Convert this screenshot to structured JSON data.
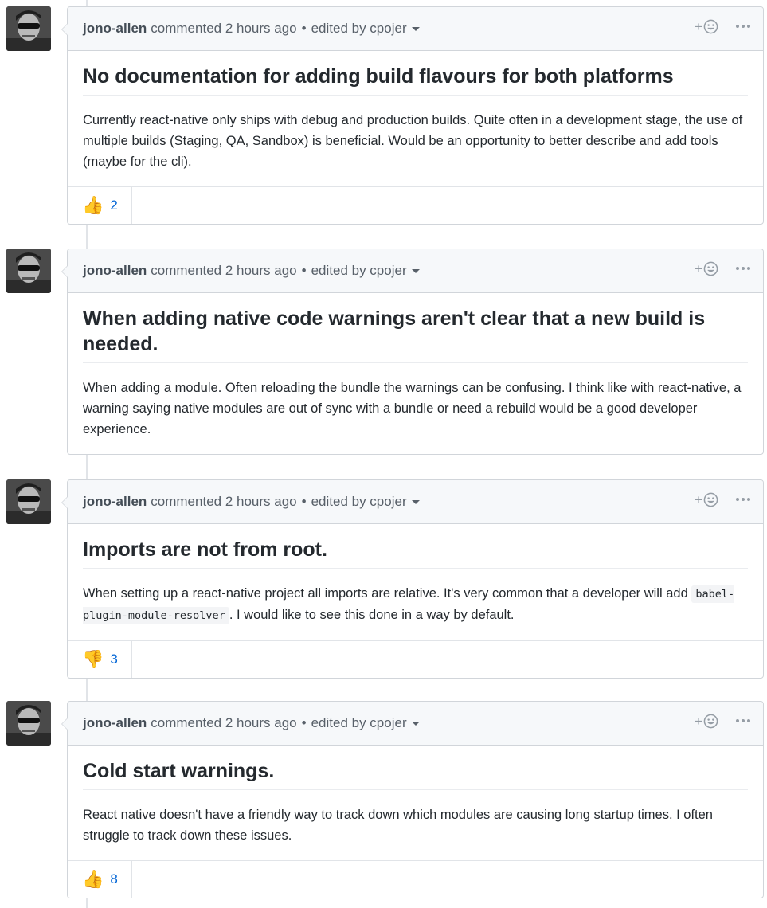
{
  "comments": [
    {
      "author": "jono-allen",
      "action": "commented 2 hours ago",
      "edited": "edited by cpojer",
      "title": "No documentation for adding build flavours for both platforms",
      "body": "Currently react-native only ships with debug and production builds. Quite often in a development stage, the use of multiple builds (Staging, QA, Sandbox) is beneficial. Would be an opportunity to better describe and add tools (maybe for the cli).",
      "reaction": {
        "emoji": "👍",
        "count": "2"
      }
    },
    {
      "author": "jono-allen",
      "action": "commented 2 hours ago",
      "edited": "edited by cpojer",
      "title": "When adding native code warnings aren't clear that a new build is needed.",
      "body": "When adding a module. Often reloading the bundle the warnings can be confusing. I think like with react-native, a warning saying native modules are out of sync with a bundle or need a rebuild would be a good developer experience."
    },
    {
      "author": "jono-allen",
      "action": "commented 2 hours ago",
      "edited": "edited by cpojer",
      "title": "Imports are not from root.",
      "body_pre": "When setting up a react-native project all imports are relative. It's very common that a developer will add ",
      "body_code": "babel-plugin-module-resolver",
      "body_post": ". I would like to see this done in a way by default.",
      "reaction": {
        "emoji": "👎",
        "count": "3"
      }
    },
    {
      "author": "jono-allen",
      "action": "commented 2 hours ago",
      "edited": "edited by cpojer",
      "title": "Cold start warnings.",
      "body": "React native doesn't have a friendly way to track down which modules are causing long startup times. I often struggle to track down these issues.",
      "reaction": {
        "emoji": "👍",
        "count": "8"
      }
    }
  ],
  "ui": {
    "dot": "•",
    "plus": "+"
  }
}
